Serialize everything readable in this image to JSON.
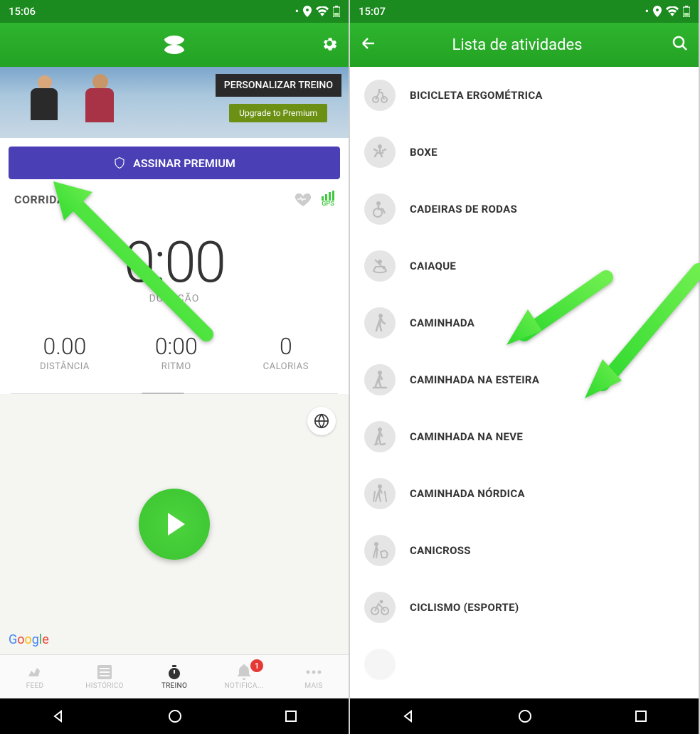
{
  "left": {
    "status_time": "15:06",
    "banner": {
      "callout": "PERSONALIZAR TREINO",
      "upgrade": "Upgrade to Premium"
    },
    "premium_label": "ASSINAR PREMIUM",
    "activity_name": "CORRIDA",
    "gps_label": "GPS",
    "timer": {
      "value": "0:00",
      "label": "DURAÇÃO"
    },
    "stats": {
      "distance": {
        "value": "0.00",
        "label": "DISTÂNCIA"
      },
      "pace": {
        "value": "0:00",
        "label": "RITMO"
      },
      "calories": {
        "value": "0",
        "label": "CALORIAS"
      }
    },
    "map_attribution": "Google",
    "tabs": {
      "feed": "FEED",
      "historico": "HISTÓRICO",
      "treino": "TREINO",
      "notifica": "NOTIFICA...",
      "mais": "MAIS",
      "badge": "1"
    }
  },
  "right": {
    "status_time": "15:07",
    "header_title": "Lista de atividades",
    "items": [
      "BICICLETA ERGOMÉTRICA",
      "BOXE",
      "CADEIRAS DE RODAS",
      "CAIAQUE",
      "CAMINHADA",
      "CAMINHADA NA ESTEIRA",
      "CAMINHADA NA NEVE",
      "CAMINHADA NÓRDICA",
      "CANICROSS",
      "CICLISMO (ESPORTE)"
    ]
  }
}
